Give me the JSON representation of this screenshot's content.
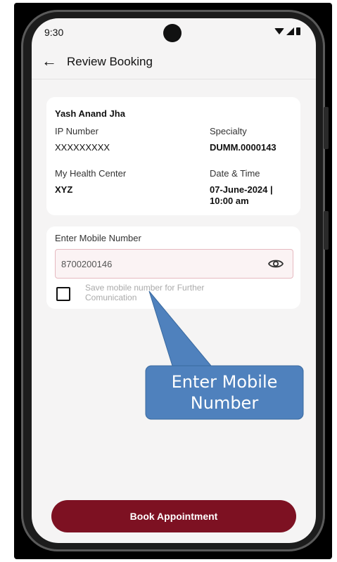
{
  "status_bar": {
    "time": "9:30"
  },
  "header": {
    "title": "Review Booking",
    "back_icon": "arrow-left-icon"
  },
  "booking": {
    "patient_name": "Yash Anand Jha",
    "ip_number_label": "IP Number",
    "ip_number_value": "XXXXXXXXX",
    "specialty_label": "Specialty",
    "specialty_value": "DUMM.0000143",
    "health_center_label": "My Health Center",
    "health_center_value": "XYZ",
    "datetime_label": "Date & Time",
    "datetime_value_line1": "07-June-2024 |",
    "datetime_value_line2": "10:00 am"
  },
  "mobile": {
    "label": "Enter Mobile Number",
    "value": "8700200146",
    "toggle_icon": "eye-icon",
    "save_checkbox_label": "Save mobile number for Further Comunication",
    "save_checked": false
  },
  "book_button_label": "Book Appointment",
  "callout": {
    "text": "Enter Mobile Number",
    "color": "#4f81bd"
  },
  "colors": {
    "accent": "#7d1122",
    "input_border": "#e6b9c0",
    "background": "#f5f4f4"
  }
}
